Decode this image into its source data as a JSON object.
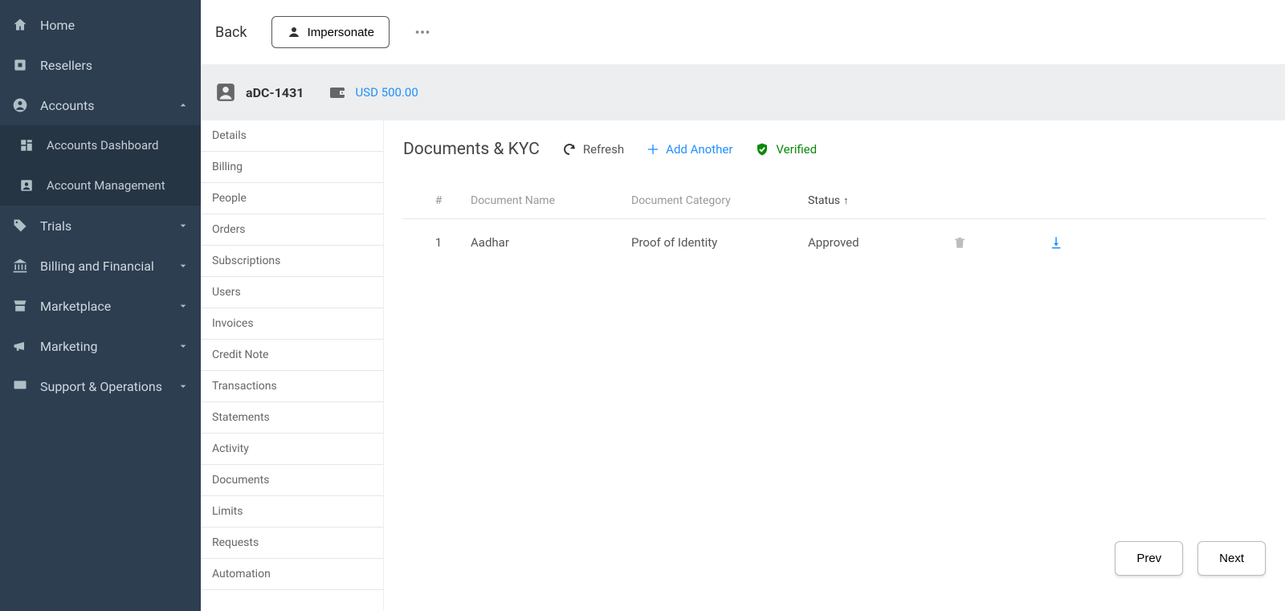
{
  "sidebar": {
    "items": [
      {
        "icon": "home",
        "label": "Home"
      },
      {
        "icon": "reseller",
        "label": "Resellers"
      },
      {
        "icon": "person-circle",
        "label": "Accounts",
        "expanded": true
      },
      {
        "icon": "tag",
        "label": "Trials",
        "expandable": true
      },
      {
        "icon": "bank",
        "label": "Billing and Financial",
        "expandable": true
      },
      {
        "icon": "store",
        "label": "Marketplace",
        "expandable": true
      },
      {
        "icon": "bullhorn",
        "label": "Marketing",
        "expandable": true
      },
      {
        "icon": "monitor",
        "label": "Support & Operations",
        "expandable": true
      }
    ],
    "accounts_children": [
      {
        "label": "Accounts Dashboard"
      },
      {
        "label": "Account Management"
      }
    ]
  },
  "topbar": {
    "back_label": "Back",
    "impersonate_label": "Impersonate"
  },
  "account": {
    "id": "aDC-1431",
    "balance": "USD 500.00"
  },
  "subnav": {
    "items": [
      "Details",
      "Billing",
      "People",
      "Orders",
      "Subscriptions",
      "Users",
      "Invoices",
      "Credit Note",
      "Transactions",
      "Statements",
      "Activity",
      "Documents",
      "Limits",
      "Requests",
      "Automation"
    ]
  },
  "panel": {
    "title": "Documents & KYC",
    "refresh_label": "Refresh",
    "add_label": "Add Another",
    "verified_label": "Verified"
  },
  "table": {
    "columns": {
      "index": "#",
      "name": "Document Name",
      "category": "Document Category",
      "status": "Status"
    },
    "sort_icon": "↑",
    "rows": [
      {
        "index": "1",
        "name": "Aadhar",
        "category": "Proof of Identity",
        "status": "Approved"
      }
    ]
  },
  "pager": {
    "prev": "Prev",
    "next": "Next"
  }
}
